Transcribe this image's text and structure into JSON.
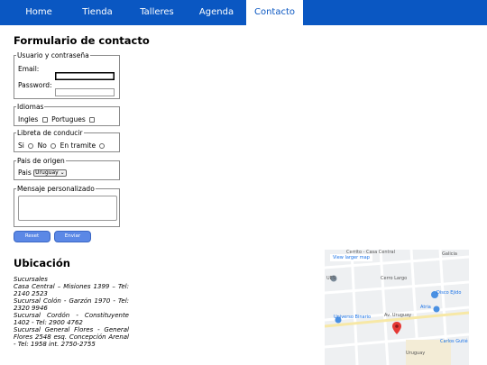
{
  "nav": {
    "items": [
      "Home",
      "Tienda",
      "Talleres",
      "Agenda",
      "Contacto"
    ],
    "active": "Contacto"
  },
  "form": {
    "title": "Formulario de contacto",
    "user": {
      "legend": "Usuario y contraseña",
      "email_label": "Email:",
      "password_label": "Password:"
    },
    "languages": {
      "legend": "Idiomas",
      "options": [
        "Ingles",
        "Portugues"
      ]
    },
    "license": {
      "legend": "Libreta de conducir",
      "options": [
        "Si",
        "No",
        "En tramite"
      ]
    },
    "country": {
      "legend": "Pais de origen",
      "label": "Pais",
      "selected": "Uruguay"
    },
    "message": {
      "legend": "Mensaje personalizado"
    },
    "buttons": {
      "reset": "Reset",
      "send": "Enviar"
    }
  },
  "location": {
    "title": "Ubicación",
    "lines": [
      "Sucursales",
      "Casa Central – Misiones 1399 – Tel:",
      "2140 2523",
      "Sucursal Colón - Garzón 1970 - Tel:",
      "2320 9946",
      "Sucursal Cordón - Constituyente",
      "1402 - Tel: 2900 4762",
      "Sucursal General Flores - General",
      "Flores 2548 esq. Concepción Arenal",
      "- Tel: 1958 int. 2750-2755"
    ]
  },
  "map": {
    "larger_link": "View larger map",
    "labels": [
      "Cerrito - Casa Central",
      "Galicia",
      "Cerro Largo",
      "Disco Ejido",
      "UES",
      "Atria",
      "Universo Binario",
      "Av. Uruguay",
      "Carlos Gutié",
      "Uruguay"
    ],
    "pin_color": "#e53935"
  },
  "colors": {
    "nav_bg": "#0a57c2",
    "button": "#5b88e6"
  }
}
